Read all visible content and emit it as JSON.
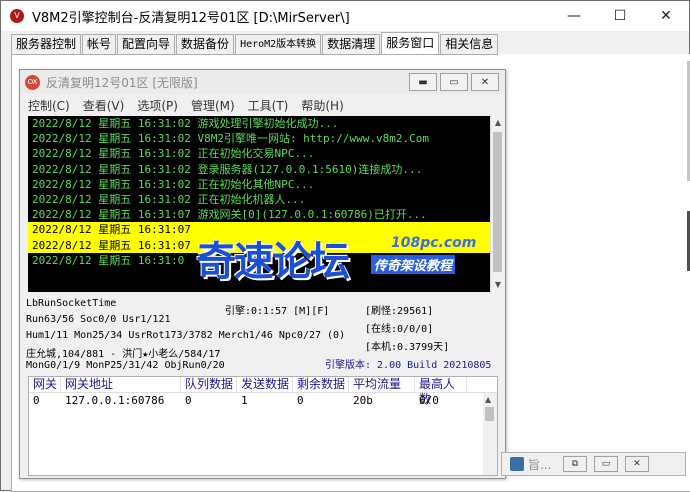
{
  "window": {
    "title": "V8M2引擎控制台-反清复明12号01区 [D:\\MirServer\\]",
    "app_icon": "V",
    "controls": {
      "minimize": "—",
      "maximize": "☐",
      "close": "✕"
    }
  },
  "tabs": [
    {
      "label": "服务器控制",
      "mono": false,
      "active": false
    },
    {
      "label": "帐号",
      "mono": false,
      "active": false
    },
    {
      "label": "配置向导",
      "mono": false,
      "active": false
    },
    {
      "label": "数据备份",
      "mono": false,
      "active": false
    },
    {
      "label": "HeroM2版本转换",
      "mono": true,
      "active": false
    },
    {
      "label": "数据清理",
      "mono": false,
      "active": false
    },
    {
      "label": "服务窗口",
      "mono": false,
      "active": true
    },
    {
      "label": "相关信息",
      "mono": false,
      "active": false
    }
  ],
  "inner_window": {
    "icon_text": "OX",
    "title": "反清复明12号01区 [无限版]",
    "menu": [
      "控制(C)",
      "查看(V)",
      "选项(P)",
      "管理(M)",
      "工具(T)",
      "帮助(H)"
    ],
    "console_lines": [
      {
        "text": "2022/8/12 星期五 16:31:02 游戏处理引擎初始化成功...",
        "highlight": false
      },
      {
        "text": "2022/8/12 星期五 16:31:02 V8M2引擎唯一网站: http://www.v8m2.Com",
        "highlight": false
      },
      {
        "text": "2022/8/12 星期五 16:31:02 正在初始化交易NPC...",
        "highlight": false
      },
      {
        "text": "2022/8/12 星期五 16:31:02 登录服务器(127.0.0.1:5610)连接成功...",
        "highlight": false
      },
      {
        "text": "2022/8/12 星期五 16:31:02 正在初始化其他NPC...",
        "highlight": false
      },
      {
        "text": "2022/8/12 星期五 16:31:02 正在初始化机器人...",
        "highlight": false
      },
      {
        "text": "2022/8/12 星期五 16:31:07 游戏网关[0](127.0.0.1:60786)已打开...",
        "highlight": false
      },
      {
        "text": "2022/8/12 星期五 16:31:07",
        "highlight": true
      },
      {
        "text": "2022/8/12 星期五 16:31:07",
        "highlight": true
      },
      {
        "text": "2022/8/12 星期五 16:31:0",
        "highlight": false
      }
    ],
    "status": {
      "run_socket": "LbRunSocketTime",
      "engine_time": "引擎:0:1:57 [M][F]",
      "refresh": "[刷怪:29561]",
      "run_line": "Run63/56 Soc0/0 Usr1/121",
      "online": "[在线:0/0/0]",
      "hum_line": "Hum1/11 Mon25/34 UsrRot173/3782 Merch1/46 Npc0/27 (0)",
      "local": "[本机:0.3799天]",
      "player_line": "庄允城,104/881 - 洪门★小老么/584/17",
      "engine_version": "引擎版本: 2.00 Build 20210805",
      "mon_line": "MonG0/1/9 MonP25/31/42 ObjRun0/20"
    },
    "table": {
      "columns": [
        "网关",
        "网关地址",
        "队列数据",
        "发送数据",
        "剩余数据",
        "平均流量",
        "最高人数"
      ],
      "rows": [
        [
          "0",
          "127.0.0.1:60786",
          "0",
          "1",
          "0",
          "20b",
          "0/0"
        ]
      ]
    }
  },
  "minimized_window": {
    "label": "旨..."
  },
  "watermark": {
    "big": "奇速论坛",
    "url": "108pc.com",
    "sub": "传奇架设教程"
  }
}
